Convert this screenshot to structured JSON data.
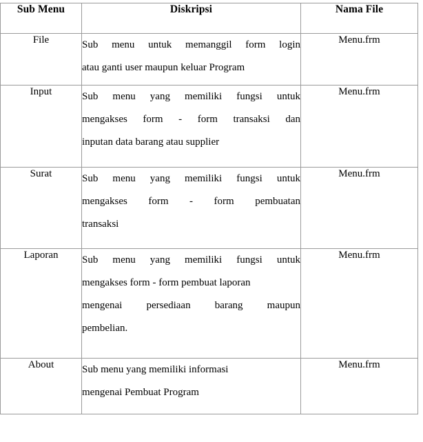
{
  "table": {
    "columns": [
      {
        "key": "sub_menu",
        "label": "Sub Menu"
      },
      {
        "key": "diskripsi",
        "label": "Diskripsi"
      },
      {
        "key": "nama_file",
        "label": "Nama File"
      }
    ],
    "rows": [
      {
        "sub_menu": "File",
        "diskripsi_line1": "Sub menu untuk memanggil form login",
        "diskripsi_line2": "atau ganti user maupun keluar Program",
        "diskripsi_line3": "",
        "diskripsi_line4": "",
        "diskripsi_full": "Sub menu untuk memanggil form login atau ganti user maupun keluar Program",
        "nama_file": "Menu.frm"
      },
      {
        "sub_menu": "Input",
        "diskripsi_line1": "Sub menu yang memiliki fungsi untuk",
        "diskripsi_line2": "mengakses form - form transaksi dan",
        "diskripsi_line3": "inputan data barang atau supplier",
        "diskripsi_line4": "",
        "diskripsi_full": "Sub menu yang memiliki fungsi untuk mengakses form - form transaksi dan inputan data barang atau supplier",
        "nama_file": "Menu.frm"
      },
      {
        "sub_menu": "Surat",
        "diskripsi_line1": "Sub menu yang memiliki fungsi untuk",
        "diskripsi_line2": "mengakses form - form pembuatan",
        "diskripsi_line3": "transaksi",
        "diskripsi_line4": "",
        "diskripsi_full": "Sub menu yang memiliki fungsi untuk mengakses form - form pembuatan transaksi",
        "nama_file": "Menu.frm"
      },
      {
        "sub_menu": "Laporan",
        "diskripsi_line1": "Sub menu yang memiliki fungsi untuk",
        "diskripsi_line2": "mengakses form - form pembuat laporan",
        "diskripsi_line3": "mengenai persediaan barang maupun",
        "diskripsi_line4": "pembelian.",
        "diskripsi_full": "Sub menu yang memiliki fungsi untuk mengakses form - form pembuat laporan mengenai persediaan barang maupun pembelian.",
        "nama_file": "Menu.frm"
      },
      {
        "sub_menu": "About",
        "diskripsi_line1": "Sub menu yang memiliki informasi",
        "diskripsi_line2": "mengenai Pembuat Program",
        "diskripsi_line3": "",
        "diskripsi_line4": "",
        "diskripsi_full": "Sub menu yang memiliki informasi mengenai Pembuat Program",
        "nama_file": "Menu.frm"
      }
    ]
  },
  "style": {
    "border_color": "#9a9a9a",
    "text_color": "#000000",
    "background_color": "#ffffff"
  }
}
